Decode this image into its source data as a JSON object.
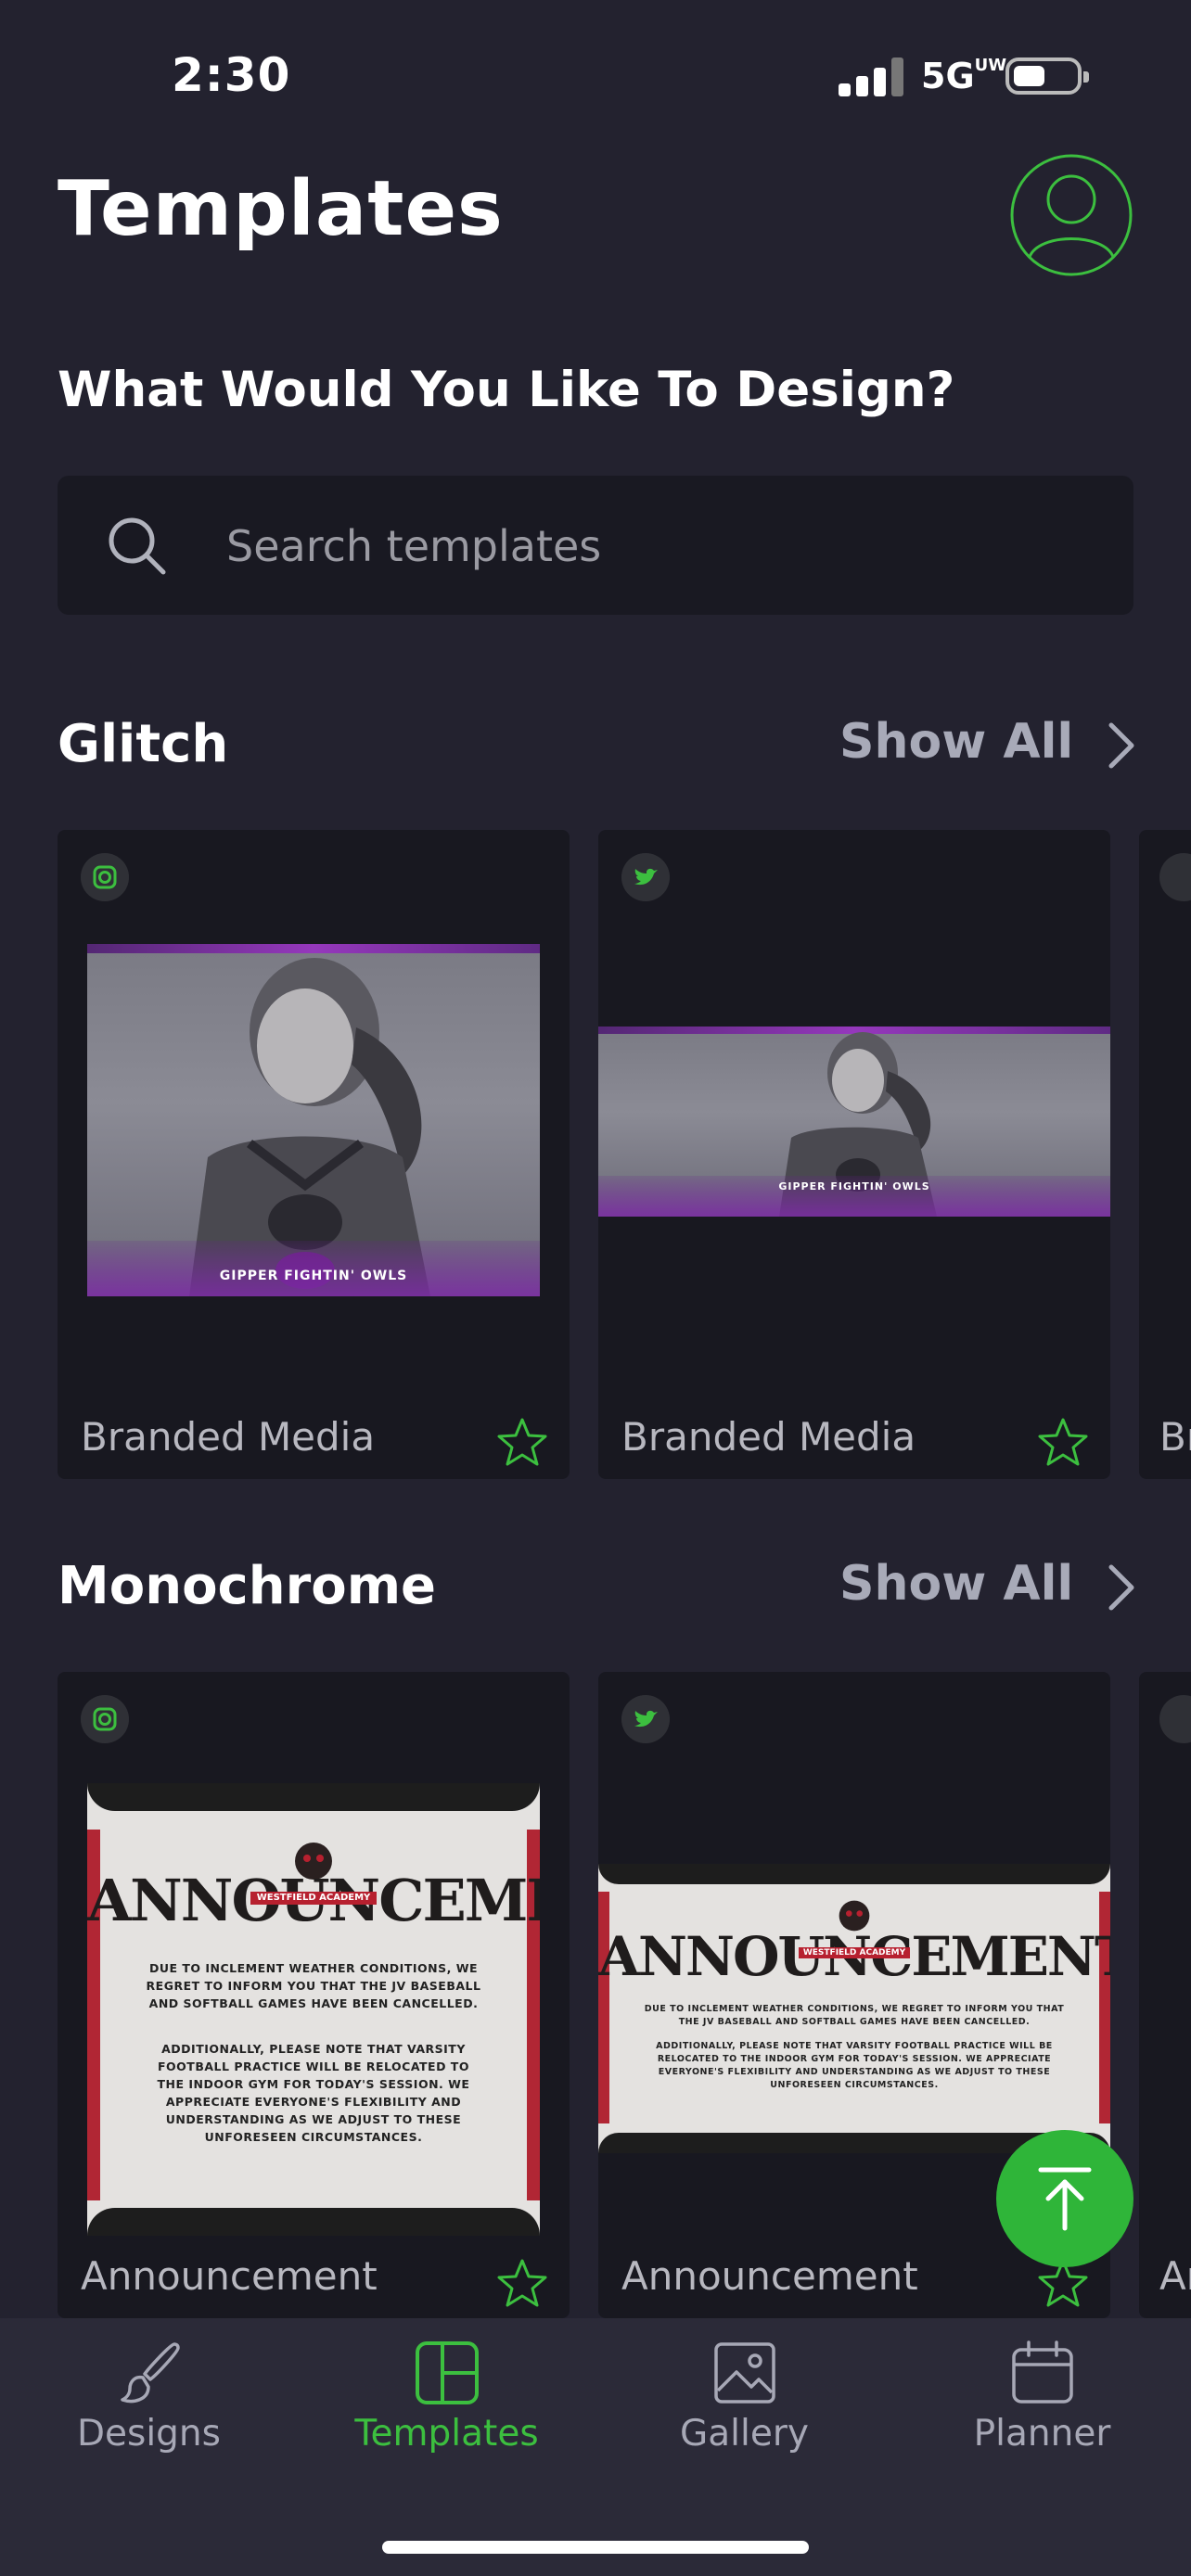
{
  "status_bar": {
    "time": "2:30",
    "network": "5G",
    "network_sup": "UW"
  },
  "header": {
    "title": "Templates"
  },
  "prompt": "What Would You Like To Design?",
  "search": {
    "placeholder": "Search templates"
  },
  "sections": [
    {
      "title": "Glitch",
      "show_all": "Show All",
      "cards": [
        {
          "platform_icon": "instagram-icon",
          "label": "Branded Media",
          "art_caption": "GIPPER FIGHTIN' OWLS"
        },
        {
          "platform_icon": "twitter-icon",
          "label": "Branded Media",
          "art_caption": "GIPPER FIGHTIN' OWLS"
        },
        {
          "platform_icon": "story-icon",
          "label": "Br"
        }
      ]
    },
    {
      "title": "Monochrome",
      "show_all": "Show All",
      "cards": [
        {
          "platform_icon": "instagram-icon",
          "label": "Announcement",
          "art_title": "ANNOUNCEMENT",
          "art_tag": "WESTFIELD ACADEMY",
          "art_body_1": "DUE TO INCLEMENT WEATHER CONDITIONS, WE REGRET TO INFORM YOU THAT THE JV BASEBALL AND SOFTBALL GAMES HAVE BEEN CANCELLED.",
          "art_body_2": "ADDITIONALLY, PLEASE NOTE THAT VARSITY FOOTBALL PRACTICE WILL BE RELOCATED TO THE INDOOR GYM FOR TODAY'S SESSION. WE APPRECIATE EVERYONE'S FLEXIBILITY AND UNDERSTANDING AS WE ADJUST TO THESE UNFORESEEN CIRCUMSTANCES."
        },
        {
          "platform_icon": "twitter-icon",
          "label": "Announcement",
          "art_title": "ANNOUNCEMENT",
          "art_tag": "WESTFIELD ACADEMY",
          "art_body_1": "DUE TO INCLEMENT WEATHER CONDITIONS, WE REGRET TO INFORM YOU THAT THE JV BASEBALL AND SOFTBALL GAMES HAVE BEEN CANCELLED.",
          "art_body_2": "ADDITIONALLY, PLEASE NOTE THAT VARSITY FOOTBALL PRACTICE WILL BE RELOCATED TO THE INDOOR GYM FOR TODAY'S SESSION. WE APPRECIATE EVERYONE'S FLEXIBILITY AND UNDERSTANDING AS WE ADJUST TO THESE UNFORESEEN CIRCUMSTANCES."
        },
        {
          "platform_icon": "story-icon",
          "label": "Ar"
        }
      ]
    }
  ],
  "nav": {
    "items": [
      {
        "label": "Designs",
        "icon": "brush-icon"
      },
      {
        "label": "Templates",
        "icon": "templates-icon",
        "active": true
      },
      {
        "label": "Gallery",
        "icon": "gallery-icon"
      },
      {
        "label": "Planner",
        "icon": "calendar-icon"
      }
    ]
  },
  "colors": {
    "background": "#23222f",
    "accent": "#3cbf3f",
    "card": "#181820",
    "nav": "#2b2a38"
  }
}
